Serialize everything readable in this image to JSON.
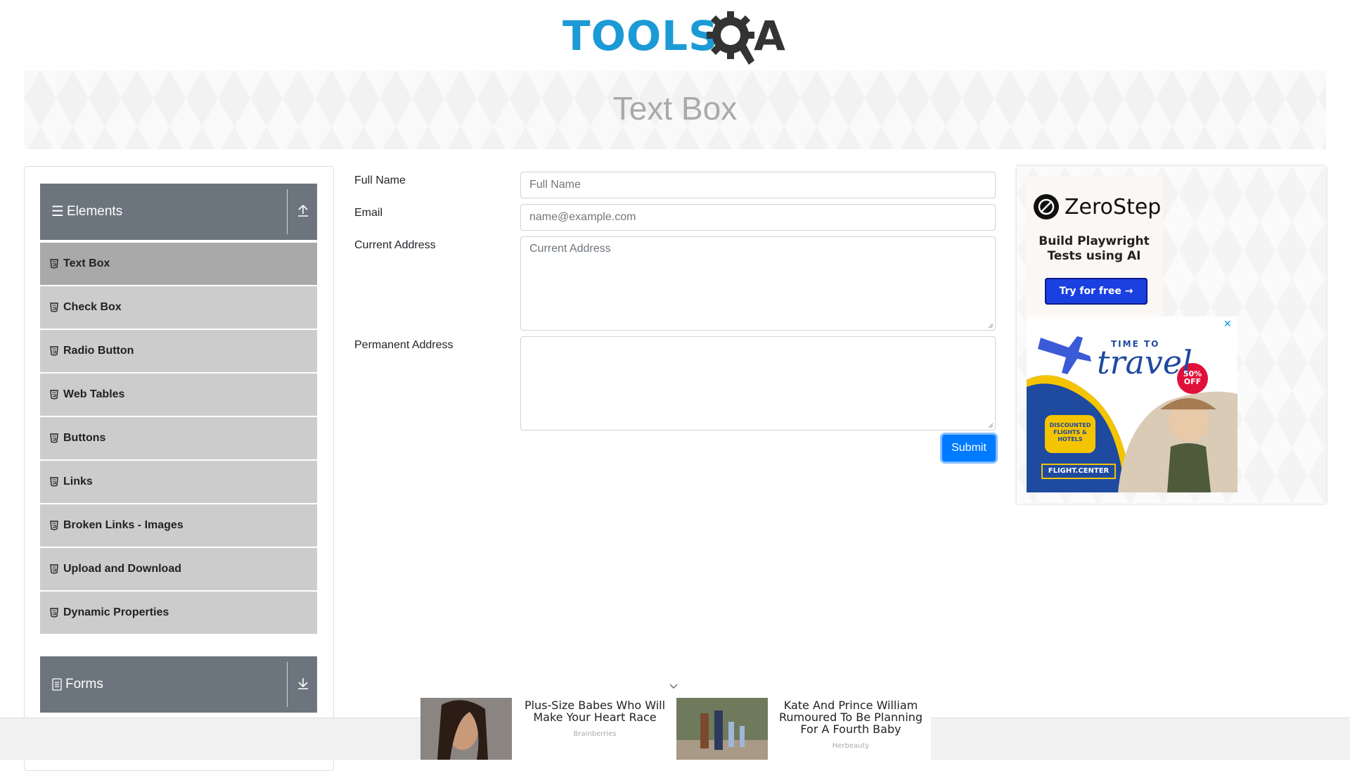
{
  "header": {
    "logo_tools": "TOOLS",
    "logo_a": "A"
  },
  "banner": {
    "title": "Text Box"
  },
  "sidebar": {
    "group_elements": "Elements",
    "items": [
      {
        "label": "Text Box"
      },
      {
        "label": "Check Box"
      },
      {
        "label": "Radio Button"
      },
      {
        "label": "Web Tables"
      },
      {
        "label": "Buttons"
      },
      {
        "label": "Links"
      },
      {
        "label": "Broken Links - Images"
      },
      {
        "label": "Upload and Download"
      },
      {
        "label": "Dynamic Properties"
      }
    ],
    "active_item": "Text Box",
    "group_forms": "Forms"
  },
  "form": {
    "full_name_label": "Full Name",
    "full_name_placeholder": "Full Name",
    "email_label": "Email",
    "email_placeholder": "name@example.com",
    "current_address_label": "Current Address",
    "current_address_placeholder": "Current Address",
    "permanent_address_label": "Permanent Address",
    "permanent_address_placeholder": "",
    "submit_label": "Submit"
  },
  "right_ad": {
    "brand": "ZeroStep",
    "tagline": "Build Playwright Tests using AI",
    "cta": "Try for free →",
    "travel_headline_1": "TIME TO",
    "travel_headline_2": "travel",
    "discount": "50% OFF",
    "badge": "DISCOUNTED FLIGHTS & HOTELS",
    "footer_brand": "FLIGHT.CENTER",
    "close": "✕"
  },
  "bottom_ads": [
    {
      "title": "Plus-Size Babes Who Will Make Your Heart Race",
      "source": "Brainberries"
    },
    {
      "title": "Kate And Prince William Rumoured To Be Planning For A Fourth Baby",
      "source": "Herbeauty"
    }
  ],
  "colors": {
    "primary": "#007bff",
    "sidebar_header": "#6c757d",
    "menu_bg": "#cccccc",
    "menu_active": "#a9a9a9",
    "logo_blue": "#1c9ad6"
  },
  "icons": [
    "hamburger-icon",
    "upload-arrow-icon",
    "html5-icon",
    "document-icon",
    "download-arrow-icon",
    "chevron-down-icon",
    "close-icon"
  ]
}
